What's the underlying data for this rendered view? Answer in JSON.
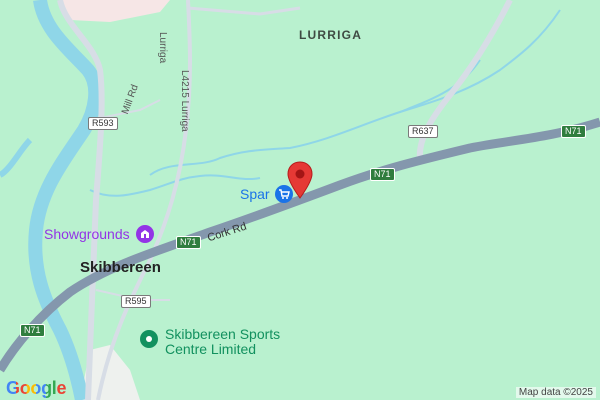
{
  "map": {
    "town_label": "Skibbereen",
    "area_label": "LURRIGA",
    "streets": {
      "cork_rd": "Cork Rd",
      "mill_rd": "Mill Rd",
      "lurriga": "Lurriga",
      "l4215": "L4215 Lurriga"
    },
    "road_shields": {
      "r593": "R593",
      "r637": "R637",
      "r595": "R595",
      "n71_a": "N71",
      "n71_b": "N71",
      "n71_c": "N71",
      "n71_d": "N71"
    },
    "pois": {
      "spar": "Spar",
      "showgrounds": "Showgrounds",
      "sports_centre_line1": "Skibbereen Sports",
      "sports_centre_line2": "Centre Limited"
    },
    "google_logo": "Google",
    "attribution": "Map data ©2025",
    "colors": {
      "land": "#b9f1cf",
      "water": "#8fd6e8",
      "major_road": "#8497ad",
      "minor_road": "#d7dde6",
      "pin": "#e53935",
      "shop_poi": "#1a73e8",
      "venue_poi": "#9334e6",
      "sports_poi": "#12915f"
    },
    "icons": {
      "pin": "map-pin-icon",
      "spar": "shopping-cart-icon",
      "showgrounds": "venue-icon",
      "sports": "sports-icon"
    }
  }
}
